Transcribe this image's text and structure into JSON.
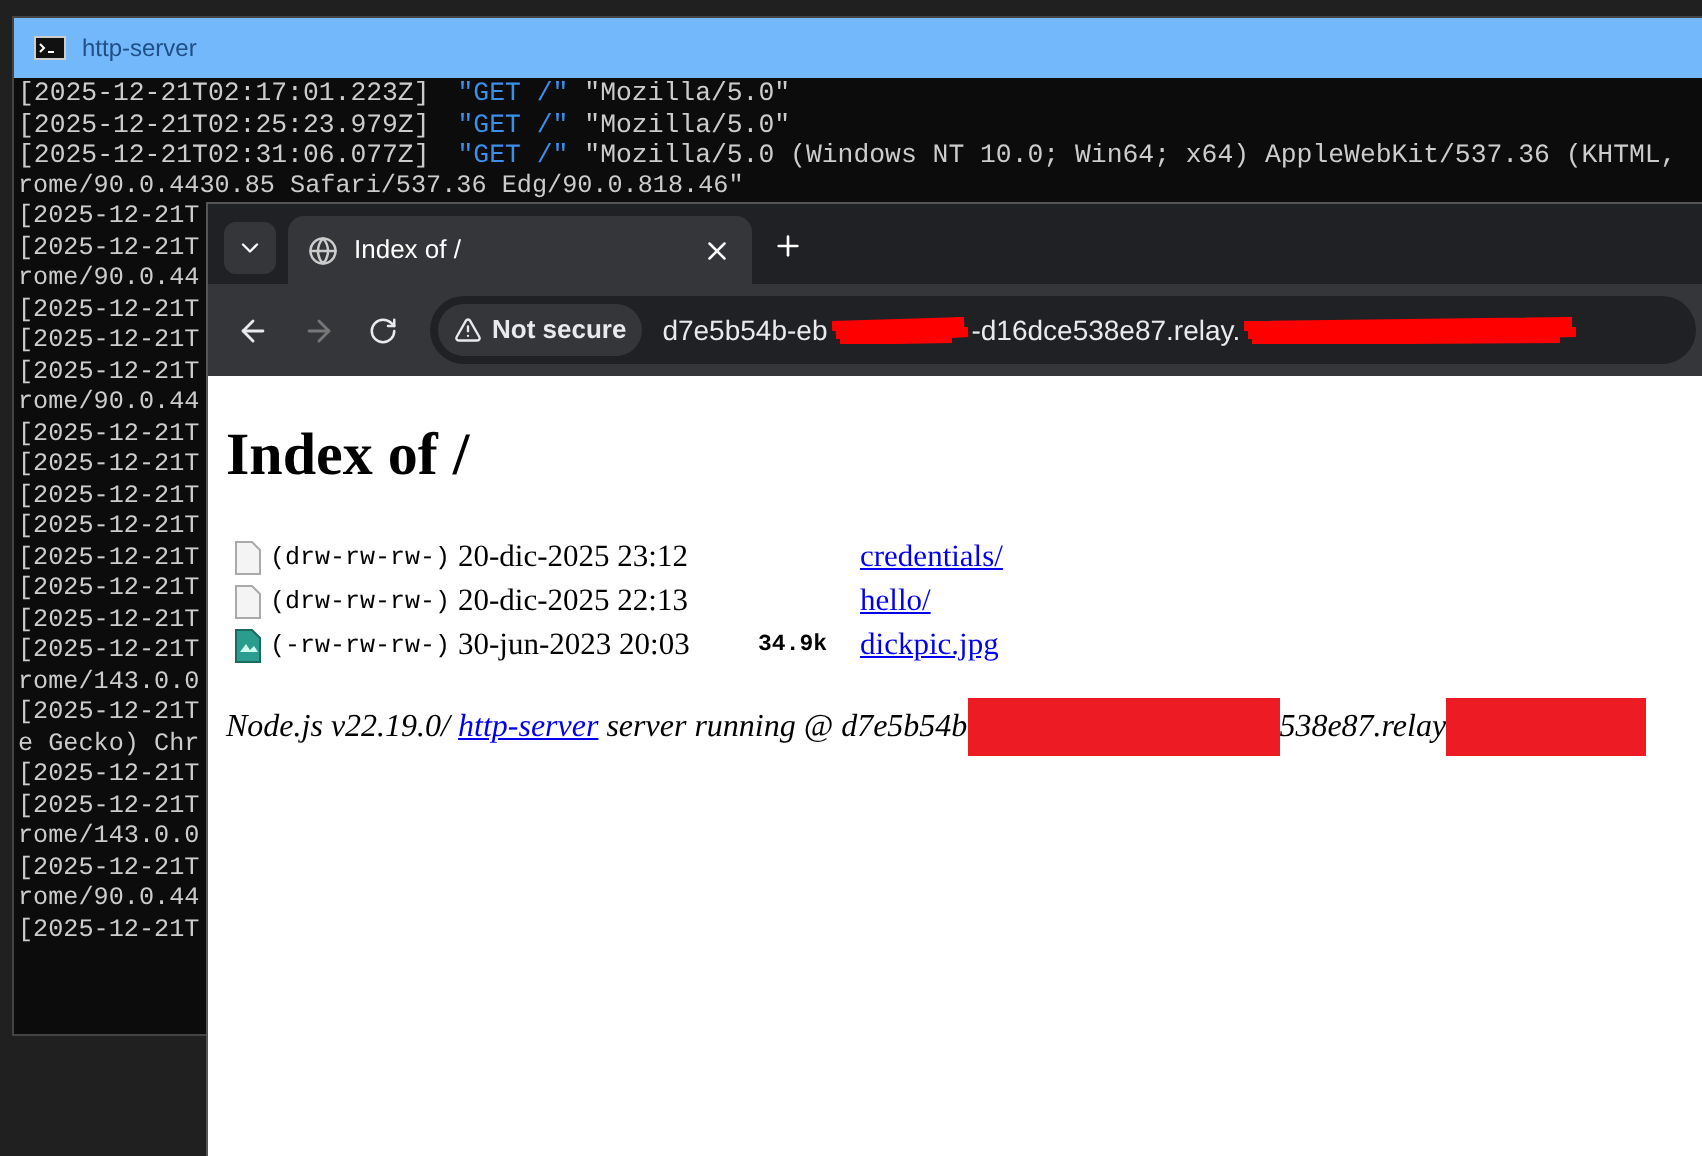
{
  "terminal": {
    "title": "http-server",
    "lines": [
      {
        "kind": "log",
        "time": "[2025-12-21T02:17:01.223Z]",
        "method": "\"GET /\"",
        "agent": "\"Mozilla/5.0\""
      },
      {
        "kind": "log",
        "time": "[2025-12-21T02:25:23.979Z]",
        "method": "\"GET /\"",
        "agent": "\"Mozilla/5.0\""
      },
      {
        "kind": "log",
        "time": "[2025-12-21T02:31:06.077Z]",
        "method": "\"GET /\"",
        "agent": "\"Mozilla/5.0 (Windows NT 10.0; Win64; x64) AppleWebKit/537.36 (KHTML,"
      },
      {
        "kind": "text",
        "text": "rome/90.0.4430.85 Safari/537.36 Edg/90.0.818.46\""
      },
      {
        "kind": "text",
        "text": "[2025-12-21T"
      },
      {
        "kind": "text",
        "text": "[2025-12-21T"
      },
      {
        "kind": "text",
        "text": "rome/90.0.44"
      },
      {
        "kind": "text",
        "text": "[2025-12-21T"
      },
      {
        "kind": "text",
        "text": "[2025-12-21T"
      },
      {
        "kind": "text",
        "text": "[2025-12-21T"
      },
      {
        "kind": "text",
        "text": "rome/90.0.44"
      },
      {
        "kind": "text",
        "text": "[2025-12-21T"
      },
      {
        "kind": "text",
        "text": "[2025-12-21T"
      },
      {
        "kind": "text",
        "text": "[2025-12-21T"
      },
      {
        "kind": "text",
        "text": "[2025-12-21T"
      },
      {
        "kind": "text",
        "text": "[2025-12-21T"
      },
      {
        "kind": "text",
        "text": "[2025-12-21T"
      },
      {
        "kind": "text",
        "text": "[2025-12-21T"
      },
      {
        "kind": "text",
        "text": "[2025-12-21T"
      },
      {
        "kind": "text",
        "text": "rome/143.0.0"
      },
      {
        "kind": "text",
        "text": "[2025-12-21T"
      },
      {
        "kind": "text",
        "text": "e Gecko) Chr"
      },
      {
        "kind": "text",
        "text": "[2025-12-21T"
      },
      {
        "kind": "text",
        "text": "[2025-12-21T"
      },
      {
        "kind": "text",
        "text": "rome/143.0.0"
      },
      {
        "kind": "text",
        "text": "[2025-12-21T"
      },
      {
        "kind": "text",
        "text": "rome/90.0.44"
      },
      {
        "kind": "text",
        "text": "[2025-12-21T"
      }
    ]
  },
  "browser": {
    "tabs": [
      {
        "title": "Index of /",
        "selected": true
      }
    ],
    "security_label": "Not secure",
    "address": {
      "start": "d7e5b54b-eb",
      "middle": "-d16dce538e87.relay."
    },
    "page": {
      "heading": "Index of /",
      "entries": [
        {
          "kind": "folder",
          "permissions": "(drw-rw-rw-)",
          "date": "20-dic-2025 23:12",
          "name": "credentials/"
        },
        {
          "kind": "folder",
          "permissions": "(drw-rw-rw-)",
          "date": "20-dic-2025 22:13",
          "name": "hello/"
        },
        {
          "kind": "image",
          "permissions": "(-rw-rw-rw-)",
          "date": "30-jun-2023 20:03",
          "size": "34.9k",
          "name": "dickpic.jpg"
        }
      ],
      "footer": {
        "prefix": "Node.js v22.19.0/",
        "link": "http-server",
        "middle": "server running @ d7e5b54b",
        "end": "538e87.relay"
      }
    }
  }
}
